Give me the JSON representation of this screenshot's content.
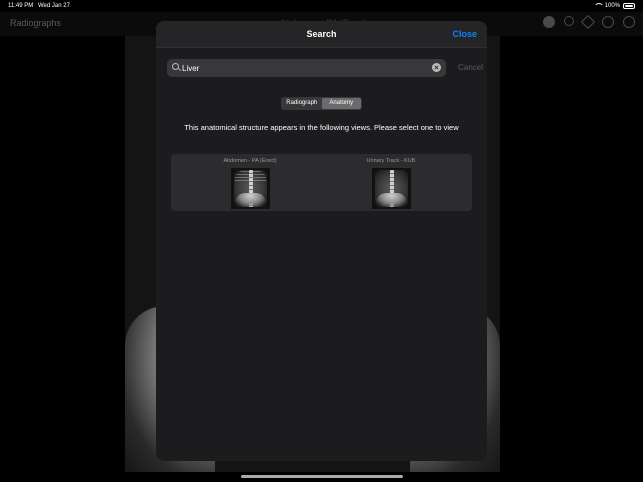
{
  "status_bar": {
    "time": "11:49 PM",
    "date": "Wed Jan 27",
    "battery": "100%"
  },
  "background": {
    "nav_title": "Radiographs",
    "center_title": "Abdomen - PA (Erect)"
  },
  "modal": {
    "title": "Search",
    "close_label": "Close",
    "search": {
      "value": "Liver",
      "placeholder": "Search",
      "cancel_label": "Cancel"
    },
    "segments": [
      {
        "label": "Radiograph",
        "selected": false
      },
      {
        "label": "Anatomy",
        "selected": true
      }
    ],
    "instruction": "This anatomical structure appears in the following views. Please select one to view",
    "views": [
      {
        "label": "Abdomen - PA (Erect)"
      },
      {
        "label": "Urinary Track - KUB"
      }
    ]
  },
  "colors": {
    "accent": "#0a84ff",
    "modal_bg": "#1c1c1e",
    "panel_bg": "#2c2c2e"
  }
}
